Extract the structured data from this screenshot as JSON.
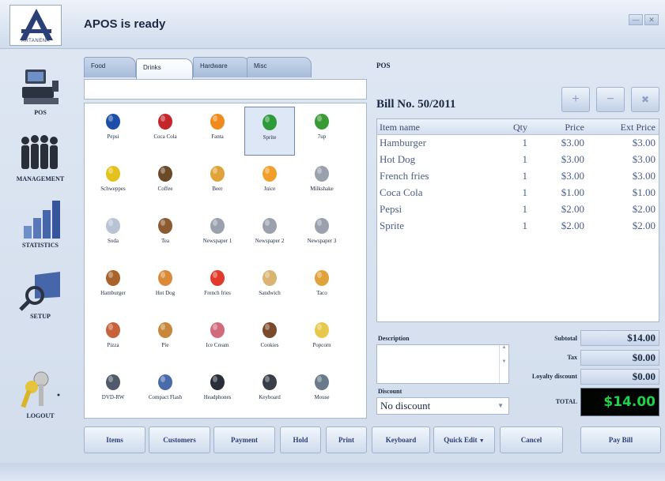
{
  "window": {
    "title": "APOS is ready",
    "logo_text": "ARTANENA"
  },
  "nav": [
    {
      "label": "POS",
      "icon": "pos-terminal-icon"
    },
    {
      "label": "MANAGEMENT",
      "icon": "people-group-icon"
    },
    {
      "label": "STATISTICS",
      "icon": "bar-chart-icon"
    },
    {
      "label": "SETUP",
      "icon": "magnifier-monitor-icon"
    },
    {
      "label": "LOGOUT",
      "icon": "keys-icon"
    }
  ],
  "tabs": [
    {
      "label": "Food"
    },
    {
      "label": "Drinks",
      "active": true
    },
    {
      "label": "Hardware"
    },
    {
      "label": "Misc"
    }
  ],
  "products": [
    {
      "label": "Pepsi",
      "icon": "pepsi-can-icon"
    },
    {
      "label": "Coca Cola",
      "icon": "cola-can-icon"
    },
    {
      "label": "Fanta",
      "icon": "fanta-can-icon"
    },
    {
      "label": "Sprite",
      "icon": "sprite-can-icon",
      "selected": true
    },
    {
      "label": "7up",
      "icon": "7up-can-icon"
    },
    {
      "label": "Schweppes",
      "icon": "schweppes-can-icon"
    },
    {
      "label": "Coffee",
      "icon": "coffee-cup-icon"
    },
    {
      "label": "Beer",
      "icon": "beer-mug-icon"
    },
    {
      "label": "Juice",
      "icon": "juice-icon"
    },
    {
      "label": "Milkshake",
      "icon": "milkshake-icon"
    },
    {
      "label": "Soda",
      "icon": "soda-glass-icon"
    },
    {
      "label": "Tea",
      "icon": "tea-cup-icon"
    },
    {
      "label": "Newspaper 1",
      "icon": "newspaper-icon"
    },
    {
      "label": "Newspaper 2",
      "icon": "newspaper-icon"
    },
    {
      "label": "Newspaper 3",
      "icon": "newspaper-icon"
    },
    {
      "label": "Hamburger",
      "icon": "hamburger-icon"
    },
    {
      "label": "Hot Dog",
      "icon": "hotdog-icon"
    },
    {
      "label": "French fries",
      "icon": "fries-icon"
    },
    {
      "label": "Sandwich",
      "icon": "sandwich-icon"
    },
    {
      "label": "Taco",
      "icon": "taco-icon"
    },
    {
      "label": "Pizza",
      "icon": "pizza-icon"
    },
    {
      "label": "Pie",
      "icon": "pie-icon"
    },
    {
      "label": "Ice Cream",
      "icon": "ice-cream-icon"
    },
    {
      "label": "Cookies",
      "icon": "cookies-icon"
    },
    {
      "label": "Popcorn",
      "icon": "popcorn-icon"
    },
    {
      "label": "DVD-RW",
      "icon": "dvd-icon"
    },
    {
      "label": "Compact Flash",
      "icon": "compact-flash-icon"
    },
    {
      "label": "Headphones",
      "icon": "headphones-icon"
    },
    {
      "label": "Keyboard",
      "icon": "keyboard-icon"
    },
    {
      "label": "Mouse",
      "icon": "mouse-icon"
    }
  ],
  "pos": {
    "section_label": "POS",
    "bill_no": "Bill No. 50/2011",
    "tool_buttons": [
      {
        "label": "+",
        "icon": "plus-icon"
      },
      {
        "label": "−",
        "icon": "minus-icon"
      },
      {
        "label": "✖",
        "icon": "remove-icon"
      }
    ],
    "columns": [
      "Item name",
      "Qty",
      "Price",
      "Ext Price"
    ],
    "rows": [
      [
        "Hamburger",
        "1",
        "$3.00",
        "$3.00"
      ],
      [
        "Hot Dog",
        "1",
        "$3.00",
        "$3.00"
      ],
      [
        "French fries",
        "1",
        "$3.00",
        "$3.00"
      ],
      [
        "Coca Cola",
        "1",
        "$1.00",
        "$1.00"
      ],
      [
        "Pepsi",
        "1",
        "$2.00",
        "$2.00"
      ],
      [
        "Sprite",
        "1",
        "$2.00",
        "$2.00"
      ]
    ],
    "description_label": "Description",
    "discount_label": "Discount",
    "discount_value": "No discount",
    "subtotal_label": "Subtotal",
    "subtotal_value": "$14.00",
    "tax_label": "Tax",
    "tax_value": "$0.00",
    "loyalty_label": "Loyalty discount",
    "loyalty_value": "$0.00",
    "total_label": "TOTAL",
    "total_value": "$14.00"
  },
  "bottom_buttons": [
    {
      "label": "Items"
    },
    {
      "label": "Customers"
    },
    {
      "label": "Payment"
    },
    {
      "label": "Hold"
    },
    {
      "label": "Print"
    },
    {
      "label": "Keyboard"
    },
    {
      "label": "Quick Edit"
    },
    {
      "label": "Cancel"
    },
    {
      "label": "Pay Bill"
    }
  ],
  "colors": {
    "accent": "#2b3f77",
    "total_text": "#22d14a",
    "total_bg": "#020402"
  }
}
